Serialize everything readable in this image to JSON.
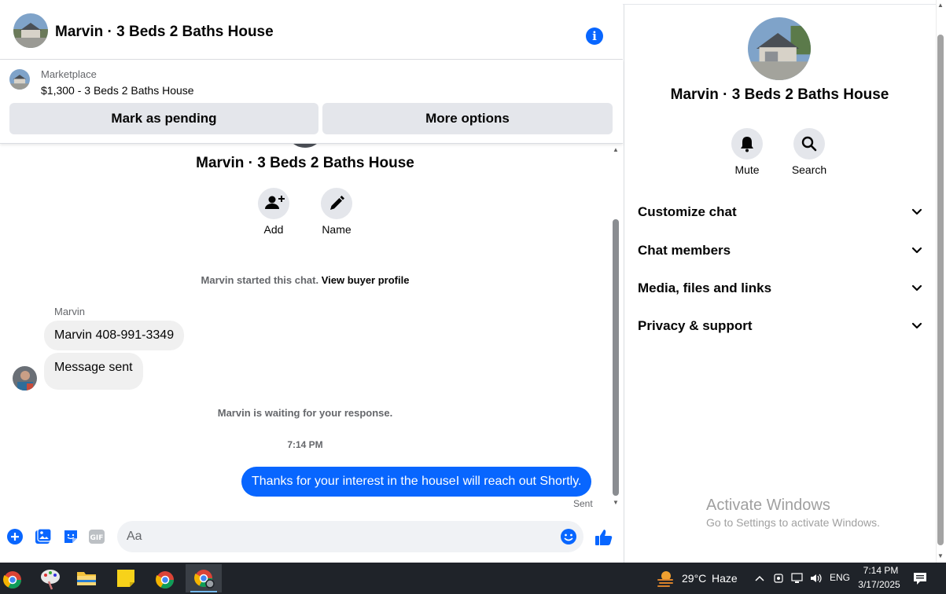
{
  "header": {
    "title": "Marvin · 3 Beds 2 Baths House"
  },
  "listing": {
    "label": "Marketplace",
    "price_title": "$1,300 - 3 Beds 2 Baths House",
    "pending_label": "Mark as pending",
    "options_label": "More options"
  },
  "conversation": {
    "title": "Marvin · 3 Beds 2 Baths House",
    "actions": [
      {
        "label": "Add"
      },
      {
        "label": "Name"
      }
    ],
    "started": "Marvin started this chat.",
    "buyer_link": "View buyer profile",
    "sender": "Marvin",
    "messages_in": [
      "Marvin 408-991-3349",
      "Message sent"
    ],
    "waiting": "Marvin is waiting for your response.",
    "time": "7:14 PM",
    "message_out": "Thanks for your interest in the houseI will reach out Shortly.",
    "status": "Sent"
  },
  "composer": {
    "placeholder": "Aa"
  },
  "side": {
    "title": "Marvin · 3 Beds 2 Baths House",
    "actions": [
      {
        "label": "Mute"
      },
      {
        "label": "Search"
      }
    ],
    "sections": [
      {
        "label": "Customize chat"
      },
      {
        "label": "Chat members"
      },
      {
        "label": "Media, files and links"
      },
      {
        "label": "Privacy & support"
      }
    ]
  },
  "watermark": {
    "title": "Activate Windows",
    "subtitle": "Go to Settings to activate Windows."
  },
  "taskbar": {
    "weather": "29°C",
    "condition": "Haze",
    "language": "ENG",
    "time": "7:14 PM",
    "date": "3/17/2025"
  },
  "colors": {
    "accent": "#0866ff",
    "bubble_in": "#f0f0f0",
    "button_gray": "#e4e6eb"
  }
}
